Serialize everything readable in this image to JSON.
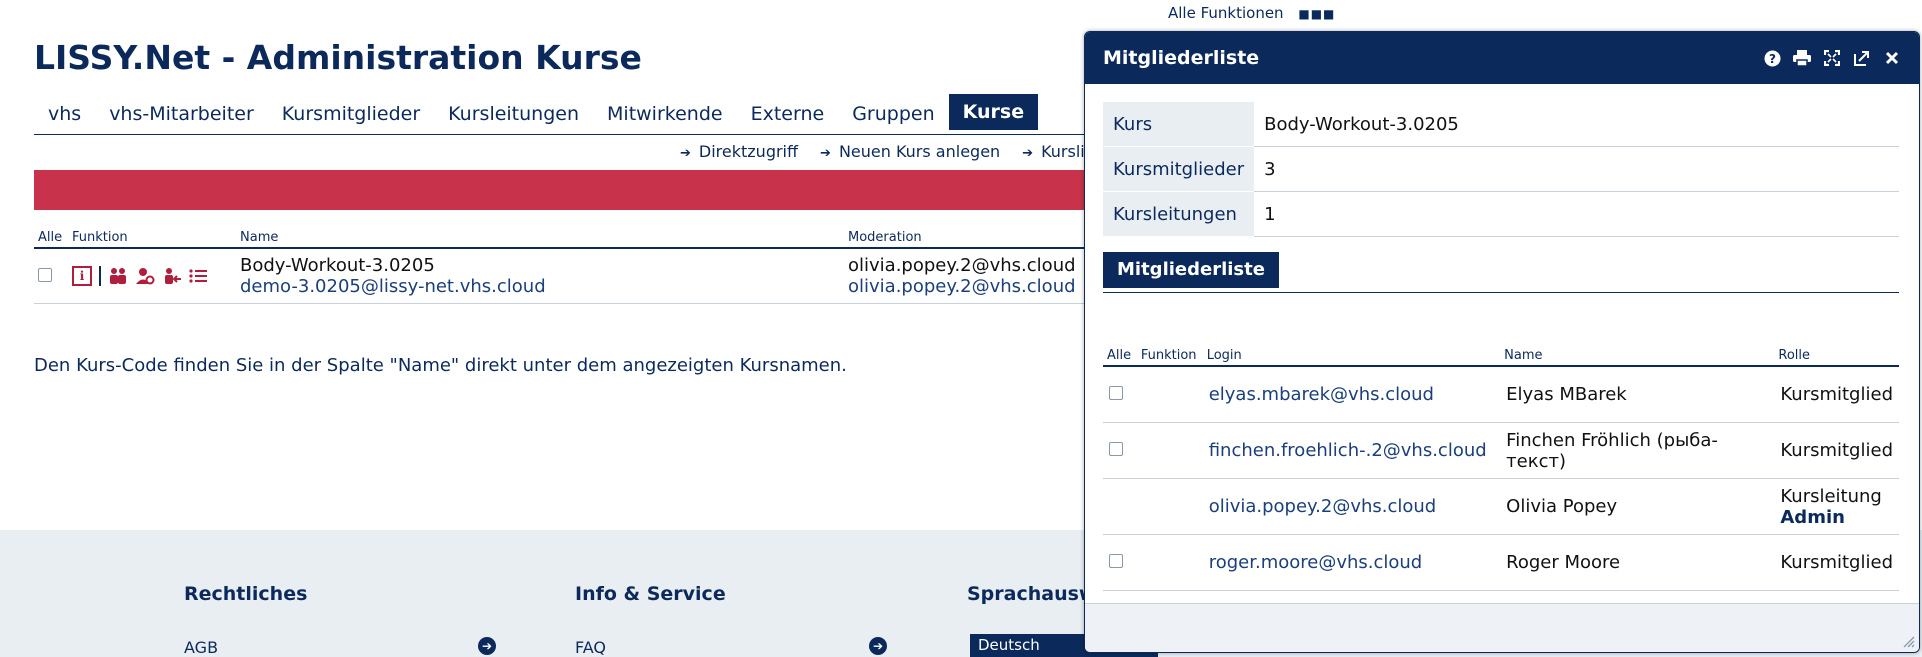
{
  "top_link": {
    "label": "Alle Funktionen"
  },
  "page": {
    "title": "LISSY.Net - Administration Kurse"
  },
  "tabs": [
    {
      "label": "vhs",
      "active": false
    },
    {
      "label": "vhs-Mitarbeiter",
      "active": false
    },
    {
      "label": "Kursmitglieder",
      "active": false
    },
    {
      "label": "Kursleitungen",
      "active": false
    },
    {
      "label": "Mitwirkende",
      "active": false
    },
    {
      "label": "Externe",
      "active": false
    },
    {
      "label": "Gruppen",
      "active": false
    },
    {
      "label": "Kurse",
      "active": true
    }
  ],
  "actions": {
    "direktzugriff": "Direktzugriff",
    "neuer_kurs": "Neuen Kurs anlegen",
    "kursliste": "Kursliste in"
  },
  "table": {
    "headers": {
      "alle": "Alle",
      "funktion": "Funktion",
      "name": "Name",
      "moderation": "Moderation"
    },
    "rows": [
      {
        "course_name": "Body-Workout-3.0205",
        "course_code": "demo-3.0205@lissy-net.vhs.cloud",
        "moderation_1": "olivia.popey.2@vhs.cloud",
        "moderation_2": "olivia.popey.2@vhs.cloud"
      }
    ]
  },
  "hint": "Den Kurs-Code finden Sie in der Spalte \"Name\" direkt unter dem angezeigten Kursnamen.",
  "footer": {
    "rechtliches": "Rechtliches",
    "info_service": "Info & Service",
    "sprachauswahl": "Sprachauswa",
    "agb": "AGB",
    "faq": "FAQ",
    "language": "Deutsch"
  },
  "dialog": {
    "title": "Mitgliederliste",
    "info": {
      "kurs_label": "Kurs",
      "kurs_value": "Body-Workout-3.0205",
      "mitglieder_label": "Kursmitglieder",
      "mitglieder_value": "3",
      "leitungen_label": "Kursleitungen",
      "leitungen_value": "1"
    },
    "sub_tab": "Mitgliederliste",
    "headers": {
      "alle": "Alle",
      "funktion": "Funktion",
      "login": "Login",
      "name": "Name",
      "rolle": "Rolle"
    },
    "members": [
      {
        "login": "elyas.mbarek@vhs.cloud",
        "name": "Elyas MBarek",
        "rolle": "Kursmitglied",
        "checkbox": true
      },
      {
        "login": "finchen.froehlich-.2@vhs.cloud",
        "name": "Finchen Fröhlich (рыба-текст)",
        "rolle": "Kursmitglied",
        "checkbox": true
      },
      {
        "login": "olivia.popey.2@vhs.cloud",
        "name": "Olivia Popey",
        "rolle": "Kursleitung",
        "rolle2": "Admin",
        "checkbox": false
      },
      {
        "login": "roger.moore@vhs.cloud",
        "name": "Roger Moore",
        "rolle": "Kursmitglied",
        "checkbox": true
      }
    ]
  },
  "colors": {
    "primary": "#0b2a5b",
    "alert": "#c8334b",
    "icon_red": "#b01e3c",
    "footer_bg": "#e9eef3"
  }
}
